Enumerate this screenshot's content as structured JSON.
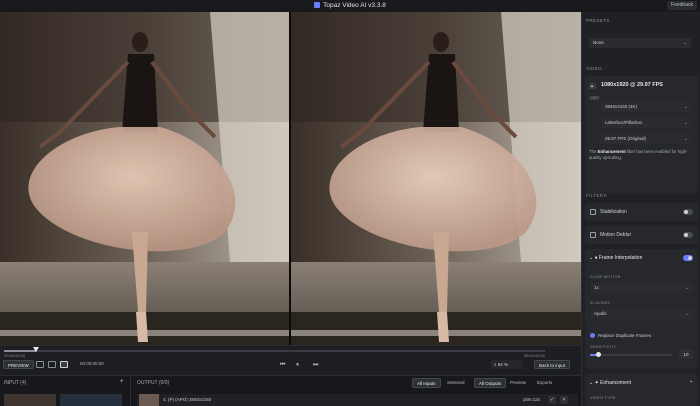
{
  "title_bar": {
    "title": "Topaz Video AI  v3.3.8",
    "feedback": "Feedback"
  },
  "timeline": {
    "start_time": "00:00:00;00",
    "end_time": "00:00:00;00",
    "progress": 0.06,
    "preview_label": "PREVIEW",
    "timecode": "00:00:00;00",
    "zoom": "64 %",
    "back_to_input": "Back to input"
  },
  "bottom": {
    "input_label": "INPUT (4)",
    "output_label": "OUTPUT (0/0)",
    "tabs": [
      "All Inputs",
      "Selected",
      "All Outputs",
      "Preview",
      "Exports"
    ],
    "row": {
      "meta": "4:  (P)   (APO)   3840x2160",
      "duration": "18m:12s"
    }
  },
  "panel": {
    "presets_label": "PRESETS",
    "preset_value": "None",
    "video_label": "VIDEO",
    "video_res": "1080x1920 @ 29.97 FPS",
    "out_badge": "OUT",
    "resolution": "3840x2160 (4K)",
    "crop": "Letterbox/Pillarbox",
    "fps": "29.97 FPS (Original)",
    "note_bold": "Enhancement",
    "note_pre": "The ",
    "note_post": " filter has been enabled for high-quality upscaling.",
    "filters_label": "FILTERS",
    "filters": [
      {
        "name": "Stabilization",
        "on": false
      },
      {
        "name": "Motion Deblur",
        "on": false
      }
    ],
    "frame_interp": {
      "name": "Frame Interpolation",
      "on": true,
      "slow_motion_label": "SLOW MOTION",
      "slow_motion": "1x",
      "ai_model_label": "AI MODEL",
      "ai_model": "Apollo",
      "replace_dup": "Replace Duplicate Frames",
      "sensitivity_label": "SENSITIVITY",
      "sensitivity": "10",
      "sensitivity_fraction": 0.1
    },
    "enhancement": {
      "name": "Enhancement",
      "video_type_label": "VIDEO TYPE"
    }
  }
}
